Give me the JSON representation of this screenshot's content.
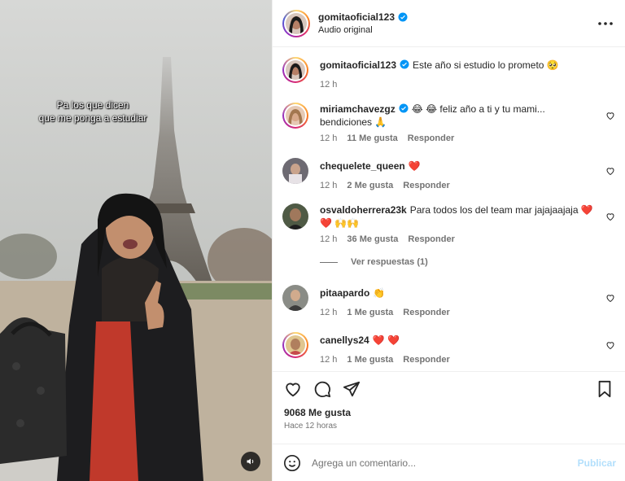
{
  "post": {
    "overlay_lines": [
      "Pa los que dicen",
      "que me ponga a estudiar"
    ]
  },
  "header": {
    "username": "gomitaoficial123",
    "subtitle": "Audio original",
    "more_label": "•••"
  },
  "caption": {
    "username": "gomitaoficial123",
    "text": "Este año si estudio lo prometo 🥺",
    "time": "12 h"
  },
  "comments": [
    {
      "username": "miriamchavezgz",
      "verified": true,
      "text": "😂 😂 feliz año a ti y tu mami... bendiciones 🙏",
      "time": "12 h",
      "likes": "11 Me gusta",
      "reply": "Responder"
    },
    {
      "username": "chequelete_queen",
      "verified": false,
      "text": "❤️",
      "time": "12 h",
      "likes": "2 Me gusta",
      "reply": "Responder"
    },
    {
      "username": "osvaldoherrera23k",
      "verified": false,
      "text": "Para todos los del team mar jajajaajaja ❤️ ❤️ 🙌🙌",
      "time": "12 h",
      "likes": "36 Me gusta",
      "reply": "Responder"
    },
    {
      "username": "pitaapardo",
      "verified": false,
      "text": "👏",
      "time": "12 h",
      "likes": "1 Me gusta",
      "reply": "Responder"
    },
    {
      "username": "canellys24",
      "verified": false,
      "text": "❤️ ❤️",
      "time": "12 h",
      "likes": "1 Me gusta",
      "reply": "Responder"
    }
  ],
  "view_replies": "Ver respuestas (1)",
  "likes_count": "9068 Me gusta",
  "posted_time": "Hace 12 horas",
  "add_comment": {
    "placeholder": "Agrega un comentario...",
    "post_label": "Publicar"
  },
  "colors": {
    "verified": "#0095f6",
    "heart_red": "#ed4956",
    "post_disabled": "#b2dffc"
  }
}
